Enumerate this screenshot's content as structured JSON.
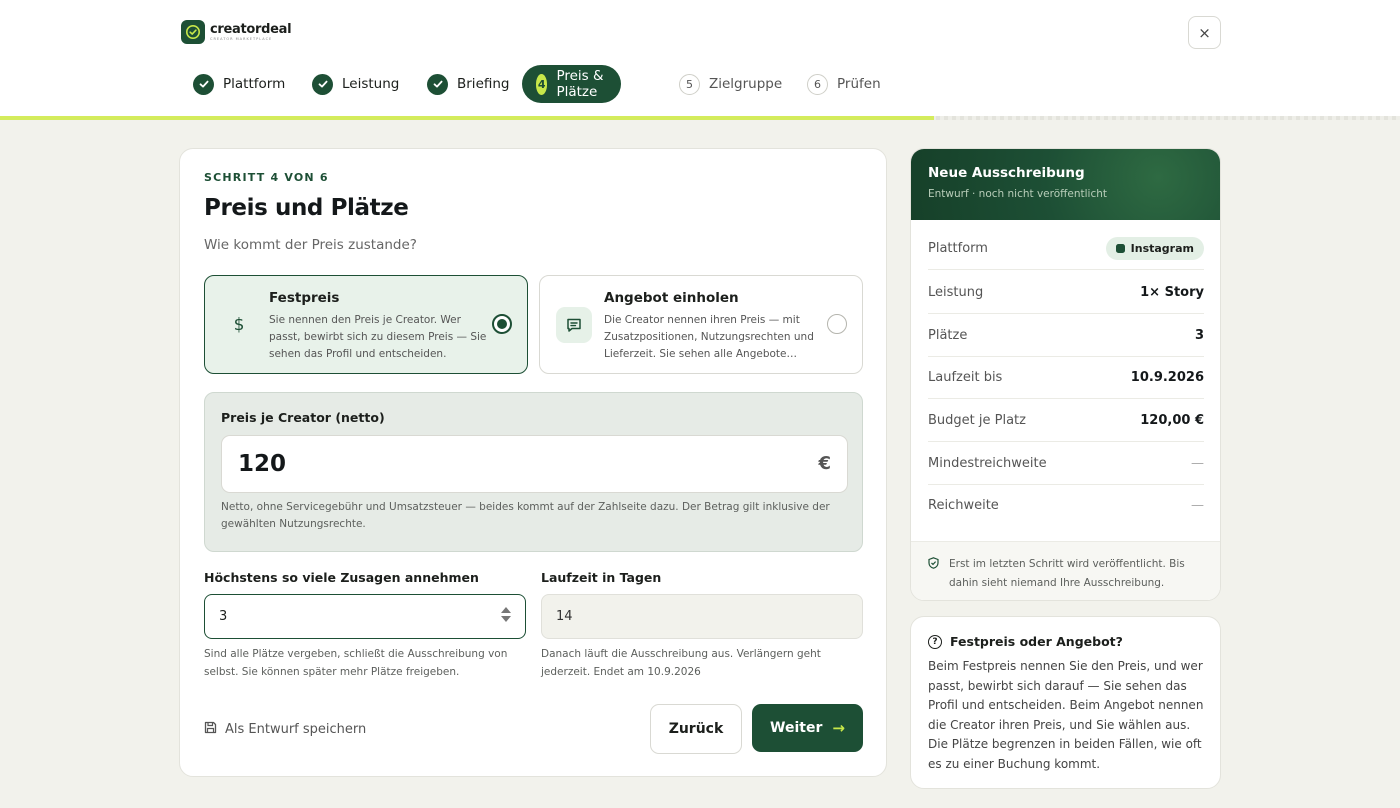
{
  "brand": {
    "name": "creatordeal",
    "tagline": "CREATOR MARKETPLACE"
  },
  "header": {
    "close_label": "×"
  },
  "steps": [
    {
      "num": "1",
      "label": "Plattform",
      "state": "done"
    },
    {
      "num": "2",
      "label": "Leistung",
      "state": "done"
    },
    {
      "num": "3",
      "label": "Briefing",
      "state": "done"
    },
    {
      "num": "4",
      "label": "Preis & Plätze",
      "state": "active"
    },
    {
      "num": "5",
      "label": "Zielgruppe",
      "state": "todo"
    },
    {
      "num": "6",
      "label": "Prüfen",
      "state": "todo"
    }
  ],
  "progress_fraction": 0.667,
  "main": {
    "step_label": "SCHRITT 4 VON 6",
    "title": "Preis und Plätze",
    "question": "Wie kommt der Preis zustande?",
    "options": [
      {
        "title": "Festpreis",
        "desc": "Sie nennen den Preis je Creator. Wer passt, bewirbt sich zu diesem Preis — Sie sehen das Profil und entscheiden.",
        "icon": "dollar-icon",
        "selected": true
      },
      {
        "title": "Angebot einholen",
        "desc": "Die Creator nennen ihren Preis — mit Zusatzpositionen, Nutzungsrechten und Lieferzeit. Sie sehen alle Angebote…",
        "icon": "chat-icon",
        "selected": false
      }
    ],
    "price": {
      "label": "Preis je Creator (netto)",
      "value": "120",
      "currency": "€",
      "hint": "Netto, ohne Servicegebühr und Umsatzsteuer — beides kommt auf der Zahlseite dazu. Der Betrag gilt inklusive der gewählten Nutzungsrechte."
    },
    "slots": {
      "label": "Höchstens so viele Zusagen annehmen",
      "value": "3",
      "hint": "Sind alle Plätze vergeben, schließt die Ausschreibung von selbst. Sie können später mehr Plätze freigeben."
    },
    "duration": {
      "label": "Laufzeit in Tagen",
      "value": "14",
      "hint": "Danach läuft die Ausschreibung aus. Verlängern geht jederzeit. Endet am 10.9.2026"
    },
    "draft_label": "Als Entwurf speichern",
    "back_label": "Zurück",
    "next_label": "Weiter"
  },
  "summary": {
    "title": "Neue Ausschreibung",
    "subtitle": "Entwurf · noch nicht veröffentlicht",
    "rows": [
      {
        "key": "Plattform",
        "value": "Instagram"
      },
      {
        "key": "Leistung",
        "value": "1× Story"
      },
      {
        "key": "Plätze",
        "value": "3"
      },
      {
        "key": "Laufzeit bis",
        "value": "10.9.2026"
      },
      {
        "key": "Budget je Platz",
        "value": "120,00 €"
      },
      {
        "key": "Mindestreichweite",
        "value": "—"
      },
      {
        "key": "Reichweite",
        "value": "—"
      }
    ],
    "footnote": "Erst im letzten Schritt wird veröffentlicht. Bis dahin sieht niemand Ihre Ausschreibung."
  },
  "info": {
    "title": "Festpreis oder Angebot?",
    "body": "Beim Festpreis nennen Sie den Preis, und wer passt, bewirbt sich darauf — Sie sehen das Profil und entscheiden. Beim Angebot nennen die Creator ihren Preis, und Sie wählen aus. Die Plätze begrenzen in beiden Fällen, wie oft es zu einer Buchung kommt."
  },
  "colors": {
    "primary": "#1d4f35",
    "accent": "#c8e84a",
    "background": "#f2f2ec"
  }
}
